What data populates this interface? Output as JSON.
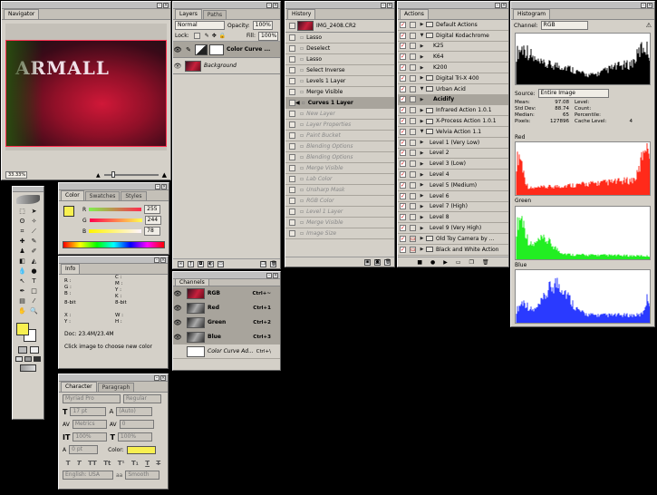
{
  "navigator": {
    "title": "Navigator",
    "zoom": "33.33%",
    "image_text": "ARMALL"
  },
  "layers": {
    "tabs": [
      "Layers",
      "Paths"
    ],
    "blend_mode": "Normal",
    "opacity_label": "Opacity:",
    "opacity": "100%",
    "lock_label": "Lock:",
    "fill_label": "Fill:",
    "fill": "100%",
    "items": [
      {
        "name": "Color Curve ...",
        "selected": true
      },
      {
        "name": "Background",
        "selected": false
      }
    ]
  },
  "history": {
    "tab": "History",
    "snapshot": "IMG_2408.CR2",
    "items": [
      {
        "name": "Lasso",
        "state": "normal"
      },
      {
        "name": "Deselect",
        "state": "normal"
      },
      {
        "name": "Lasso",
        "state": "normal"
      },
      {
        "name": "Select Inverse",
        "state": "normal"
      },
      {
        "name": "Levels 1 Layer",
        "state": "normal"
      },
      {
        "name": "Merge Visible",
        "state": "normal"
      },
      {
        "name": "Curves 1 Layer",
        "state": "selected"
      },
      {
        "name": "New Layer",
        "state": "disabled"
      },
      {
        "name": "Layer Properties",
        "state": "disabled"
      },
      {
        "name": "Paint Bucket",
        "state": "disabled"
      },
      {
        "name": "Blending Options",
        "state": "disabled"
      },
      {
        "name": "Blending Options",
        "state": "disabled"
      },
      {
        "name": "Merge Visible",
        "state": "disabled"
      },
      {
        "name": "Lab Color",
        "state": "disabled"
      },
      {
        "name": "Unsharp Mask",
        "state": "disabled"
      },
      {
        "name": "RGB Color",
        "state": "disabled"
      },
      {
        "name": "Level 1 Layer",
        "state": "disabled"
      },
      {
        "name": "Merge Visible",
        "state": "disabled"
      },
      {
        "name": "Image Size",
        "state": "disabled"
      }
    ]
  },
  "actions": {
    "tab": "Actions",
    "items": [
      {
        "name": "Default Actions",
        "level": 1,
        "tri": "▶",
        "folder": true,
        "dialog": false
      },
      {
        "name": "Digital Kodachrome",
        "level": 1,
        "tri": "▼",
        "folder": true,
        "dialog": false
      },
      {
        "name": "K25",
        "level": 2,
        "tri": "▶",
        "folder": false,
        "dialog": false
      },
      {
        "name": "K64",
        "level": 2,
        "tri": "▶",
        "folder": false,
        "dialog": false
      },
      {
        "name": "K200",
        "level": 2,
        "tri": "▶",
        "folder": false,
        "dialog": false
      },
      {
        "name": "Digital Tri-X 400",
        "level": 1,
        "tri": "▶",
        "folder": true,
        "dialog": false
      },
      {
        "name": "Urban Acid",
        "level": 1,
        "tri": "▼",
        "folder": true,
        "dialog": false
      },
      {
        "name": "Acidify",
        "level": 2,
        "tri": "▶",
        "folder": false,
        "dialog": false,
        "selected": true
      },
      {
        "name": "Infrared Action 1.0.1",
        "level": 1,
        "tri": "▶",
        "folder": true,
        "dialog": false
      },
      {
        "name": "X-Process Action 1.0.1",
        "level": 1,
        "tri": "▶",
        "folder": true,
        "dialog": false
      },
      {
        "name": "Velvia Action 1.1",
        "level": 1,
        "tri": "▼",
        "folder": true,
        "dialog": false
      },
      {
        "name": "Level 1 (Very Low)",
        "level": 3,
        "tri": "▶",
        "folder": false,
        "dialog": false
      },
      {
        "name": "Level 2",
        "level": 3,
        "tri": "▶",
        "folder": false,
        "dialog": false
      },
      {
        "name": "Level 3 (Low)",
        "level": 3,
        "tri": "▶",
        "folder": false,
        "dialog": false
      },
      {
        "name": "Level 4",
        "level": 3,
        "tri": "▶",
        "folder": false,
        "dialog": false
      },
      {
        "name": "Level 5 (Medium)",
        "level": 3,
        "tri": "▶",
        "folder": false,
        "dialog": false
      },
      {
        "name": "Level 6",
        "level": 3,
        "tri": "▶",
        "folder": false,
        "dialog": false
      },
      {
        "name": "Level 7 (High)",
        "level": 3,
        "tri": "▶",
        "folder": false,
        "dialog": false
      },
      {
        "name": "Level 8",
        "level": 3,
        "tri": "▶",
        "folder": false,
        "dialog": false
      },
      {
        "name": "Level 9 (Very High)",
        "level": 3,
        "tri": "▶",
        "folder": false,
        "dialog": false
      },
      {
        "name": "Old Toy Camera by ...",
        "level": 1,
        "tri": "▶",
        "folder": true,
        "dialog": true
      },
      {
        "name": "Black and White Action",
        "level": 1,
        "tri": "▶",
        "folder": true,
        "dialog": true
      }
    ]
  },
  "histogram": {
    "tab": "Histogram",
    "channel_label": "Channel:",
    "channel": "RGB",
    "source_label": "Source:",
    "source": "Entire Image",
    "stats": {
      "mean_label": "Mean:",
      "mean": "97.08",
      "std_label": "Std Dev:",
      "std": "88.74",
      "median_label": "Median:",
      "median": "65",
      "pixels_label": "Pixels:",
      "pixels": "127896",
      "level_label": "Level:",
      "count_label": "Count:",
      "percentile_label": "Percentile:",
      "cache_label": "Cache Level:",
      "cache": "4"
    },
    "channels": [
      {
        "name": "Red",
        "color": "#ff2a1a"
      },
      {
        "name": "Green",
        "color": "#22ee22"
      },
      {
        "name": "Blue",
        "color": "#2a3aff"
      }
    ]
  },
  "color": {
    "tabs": [
      "Color",
      "Swatches",
      "Styles"
    ],
    "r_label": "R",
    "r": "255",
    "g_label": "G",
    "g": "244",
    "b_label": "B",
    "b": "78",
    "foreground": "#f8f050"
  },
  "info": {
    "tab": "Info",
    "r_label": "R :",
    "g_label": "G :",
    "b_label": "B :",
    "c_label": "C :",
    "m_label": "M :",
    "y_label": "Y :",
    "k_label": "K :",
    "bit1": "8-bit",
    "bit2": "8-bit",
    "x_label": "X :",
    "y2_label": "Y :",
    "w_label": "W :",
    "h_label": "H :",
    "doc": "Doc: 23.4M/23.4M",
    "hint": "Click image to choose new color"
  },
  "channels_panel": {
    "tab": "Channels",
    "items": [
      {
        "name": "RGB",
        "shortcut": "Ctrl+~",
        "selected": true
      },
      {
        "name": "Red",
        "shortcut": "Ctrl+1",
        "selected": true
      },
      {
        "name": "Green",
        "shortcut": "Ctrl+2",
        "selected": true
      },
      {
        "name": "Blue",
        "shortcut": "Ctrl+3",
        "selected": true
      },
      {
        "name": "Color Curve Ad...",
        "shortcut": "Ctrl+\\",
        "selected": false
      }
    ]
  },
  "character": {
    "tabs": [
      "Character",
      "Paragraph"
    ],
    "font": "Myriad Pro",
    "style": "Regular",
    "size": "17 pt",
    "leading": "(Auto)",
    "kerning": "Metrics",
    "tracking": "0",
    "vscale": "100%",
    "hscale": "100%",
    "baseline": "0 pt",
    "color_label": "Color:",
    "text_color": "#f8f050",
    "language": "English: USA",
    "aa_label": "aa",
    "antialias": "Smooth"
  }
}
